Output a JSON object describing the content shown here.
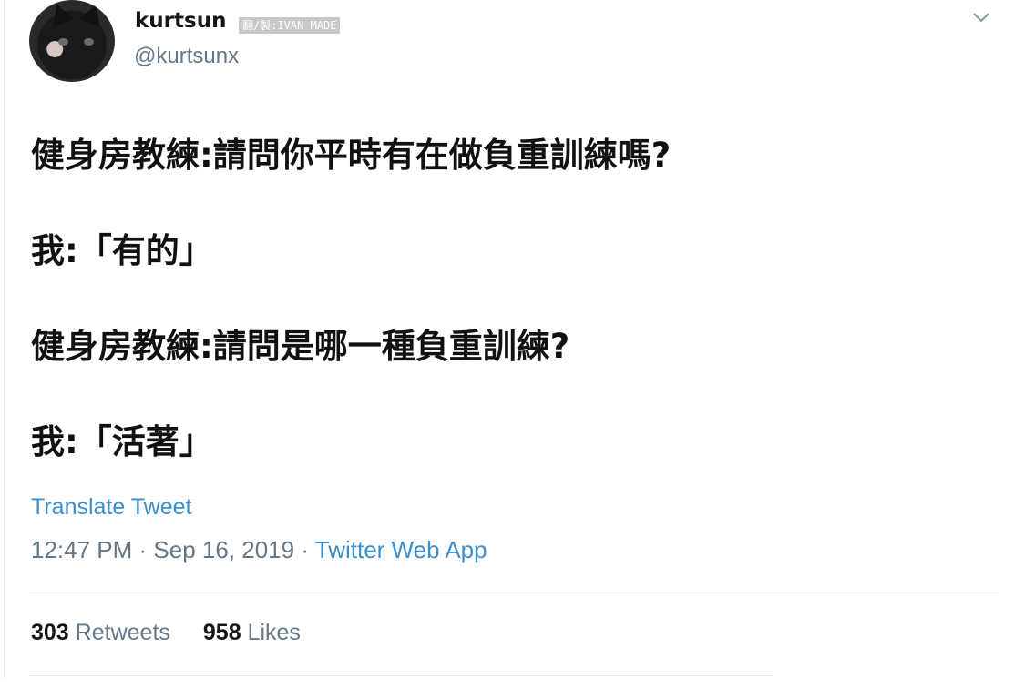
{
  "user": {
    "display_name": "kurtsun",
    "handle": "@kurtsunx",
    "watermark": "翻/製:IVAN MADE"
  },
  "icons": {
    "avatar": "black-cat-avatar",
    "menu": "chevron-down-icon"
  },
  "tweet": {
    "lines": [
      "健身房教練:請問你平時有在做負重訓練嗎?",
      "我:「有的」",
      "健身房教練:請問是哪一種負重訓練?",
      "我:「活著」"
    ],
    "translate_label": "Translate Tweet",
    "time": "12:47 PM",
    "separator": " · ",
    "date": "Sep 16, 2019",
    "app": "Twitter Web App"
  },
  "stats": {
    "retweets_count": "303",
    "retweets_label": "Retweets",
    "likes_count": "958",
    "likes_label": "Likes"
  },
  "colors": {
    "link": "#3d8fcc",
    "muted": "#657786",
    "text": "#14171a",
    "divider": "#e6ecf0"
  }
}
